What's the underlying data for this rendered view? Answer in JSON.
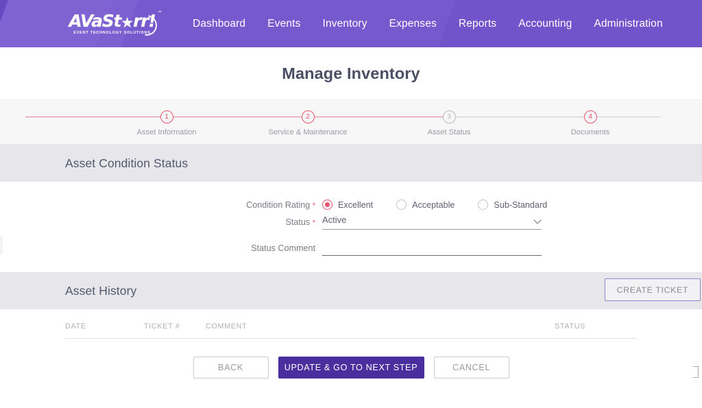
{
  "brand": {
    "logo_wordmark": "AVaSt",
    "logo_star": "★",
    "logo_wordmark_tail": "rr!",
    "logo_tm": "™",
    "logo_tagline": "EVENT TECHNOLOGY SOLUTIONS",
    "header_color": "#7154ca",
    "accent_color": "#e8546b",
    "primary_button_color": "#4b2e9e"
  },
  "nav": {
    "items": [
      {
        "label": "Dashboard"
      },
      {
        "label": "Events"
      },
      {
        "label": "Inventory"
      },
      {
        "label": "Expenses"
      },
      {
        "label": "Reports"
      },
      {
        "label": "Accounting"
      },
      {
        "label": "Administration"
      }
    ]
  },
  "page": {
    "title": "Manage Inventory"
  },
  "stepper": {
    "steps": [
      {
        "number": "1",
        "label": "Asset Information",
        "state": "complete"
      },
      {
        "number": "2",
        "label": "Service & Maintenance",
        "state": "complete"
      },
      {
        "number": "3",
        "label": "Asset Status",
        "state": "current"
      },
      {
        "number": "4",
        "label": "Documents",
        "state": "complete"
      }
    ]
  },
  "condition_section": {
    "title": "Asset Condition Status",
    "condition_rating": {
      "label": "Condition Rating",
      "required_mark": "*",
      "options": [
        {
          "label": "Excellent",
          "selected": true
        },
        {
          "label": "Acceptable",
          "selected": false
        },
        {
          "label": "Sub-Standard",
          "selected": false
        }
      ]
    },
    "status": {
      "label": "Status",
      "required_mark": "*",
      "value": "Active"
    },
    "status_comment": {
      "label": "Status Comment",
      "value": "",
      "placeholder": ""
    }
  },
  "history_section": {
    "title": "Asset History",
    "create_ticket_label": "CREATE TICKET",
    "columns": [
      "DATE",
      "TICKET #",
      "COMMENT",
      "STATUS"
    ],
    "rows": []
  },
  "footer": {
    "back_label": "BACK",
    "primary_label": "UPDATE & GO TO NEXT STEP",
    "cancel_label": "CANCEL"
  }
}
